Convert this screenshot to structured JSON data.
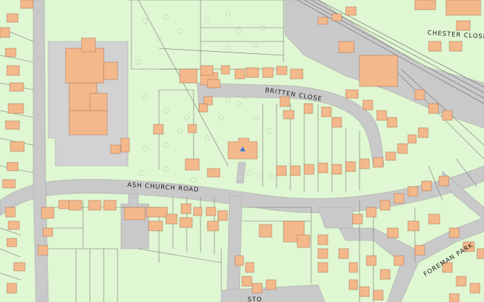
{
  "map": {
    "colors": {
      "land": "#dff7d2",
      "road": "#c9c9c9",
      "building": "#f4b98b",
      "outline": "#6f6f6f",
      "rail": "#7a7a7a"
    },
    "labels": {
      "ash_church_road": "ASH CHURCH ROAD",
      "britten_close": "BRITTEN CLOSE",
      "chester_close": "CHESTER CLOSE",
      "foreman_park": "FOREMAN PARK",
      "partial_bottom": "STO"
    }
  }
}
